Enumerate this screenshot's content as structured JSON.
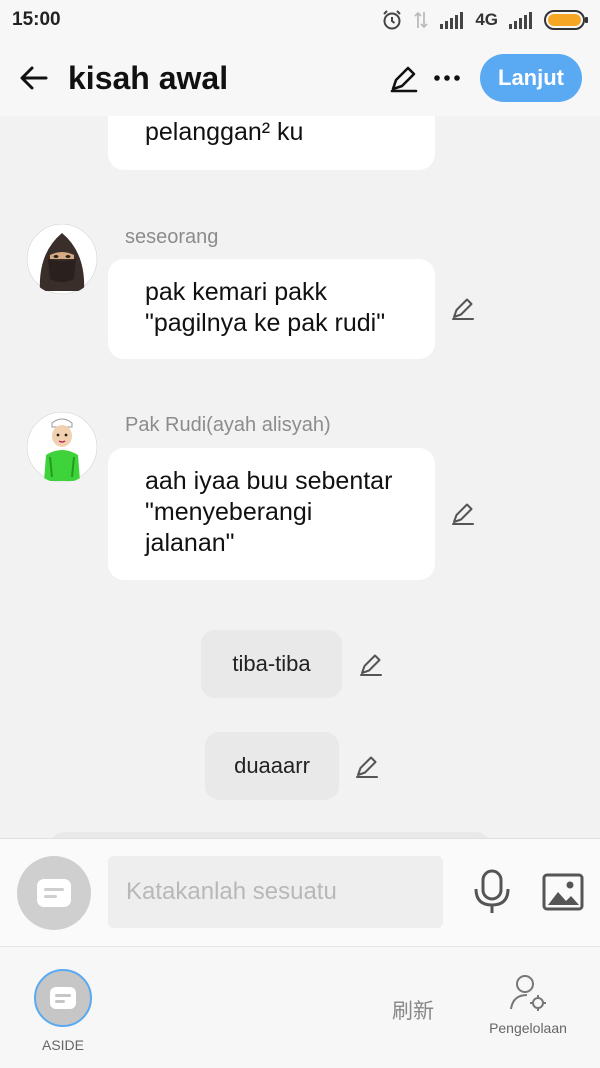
{
  "status_bar": {
    "time": "15:00",
    "network": "4G"
  },
  "header": {
    "title": "kisah awal",
    "next_label": "Lanjut"
  },
  "messages": [
    {
      "speaker": "",
      "line1": "",
      "line2": "pelanggan² ku",
      "line3": ""
    },
    {
      "speaker": "seseorang",
      "line1": "pak kemari pakk",
      "line2": "\"pagilnya ke pak rudi\"",
      "line3": ""
    },
    {
      "speaker": "Pak Rudi(ayah alisyah)",
      "line1": "aah iyaa buu sebentar",
      "line2": "\"menyeberangi",
      "line3": "jalanan\""
    }
  ],
  "narrations": [
    "tiba-tiba",
    "duaaarr"
  ],
  "composer": {
    "placeholder": "Katakanlah sesuatu"
  },
  "bottom_nav": {
    "aside_label": "ASIDE",
    "refresh_label": "刷新",
    "manage_label": "Pengelolaan"
  },
  "colors": {
    "accent": "#5aa9f3",
    "bubble": "#ffffff",
    "background": "#f2f2f2",
    "narration_bg": "#e9e9e9"
  }
}
